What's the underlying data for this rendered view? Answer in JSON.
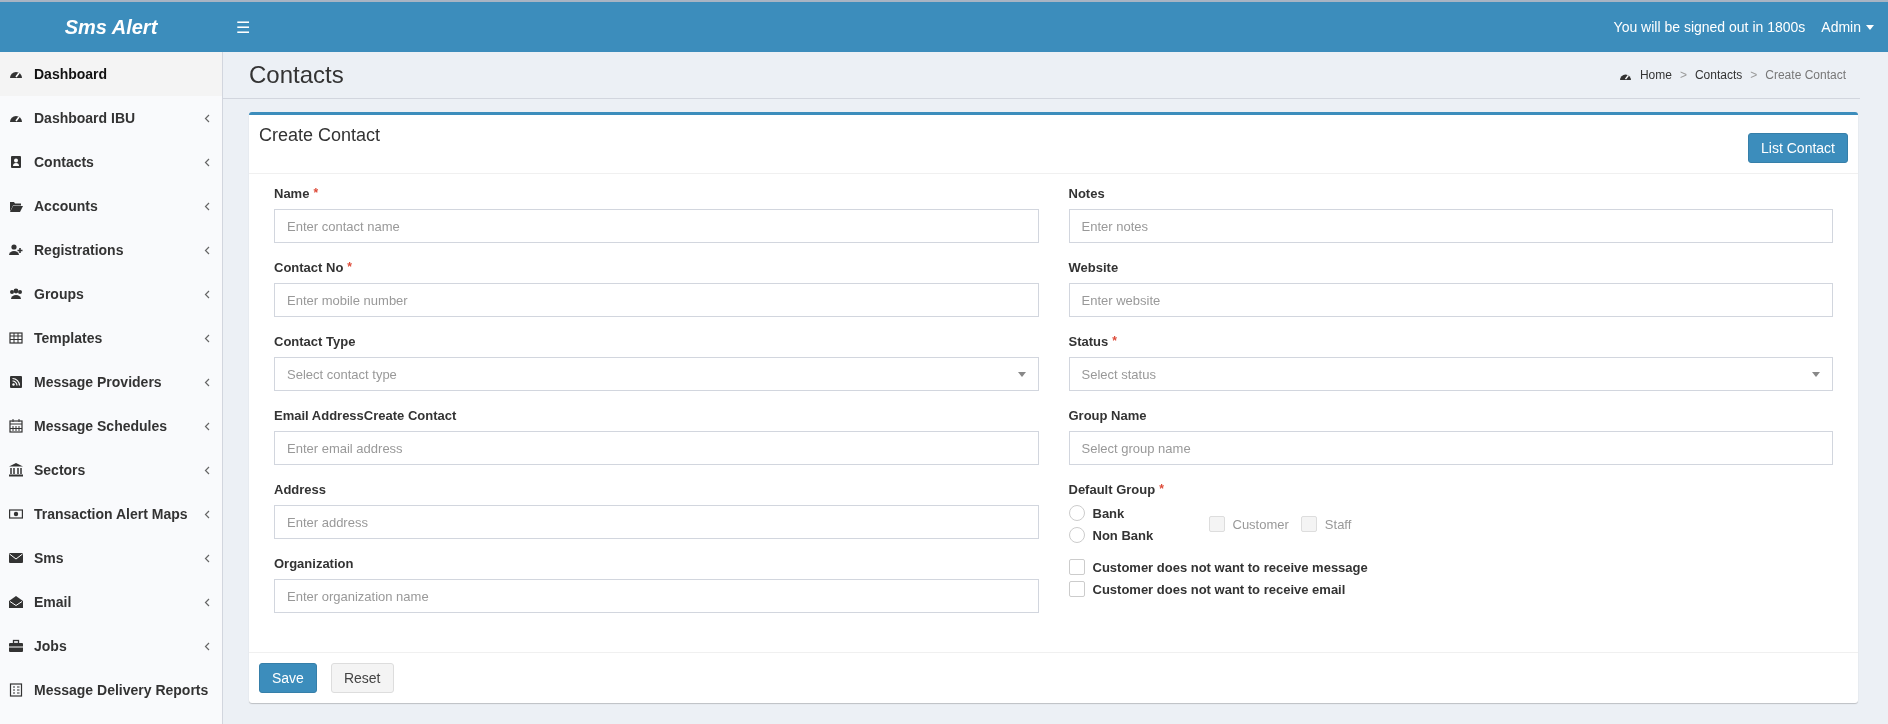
{
  "header": {
    "brand": "Sms Alert",
    "menu_toggle": "☰",
    "session_notice": "You will be signed out in 1800s",
    "user": "Admin"
  },
  "sidebar": {
    "items": [
      {
        "label": "Dashboard",
        "selected": true,
        "expandable": false
      },
      {
        "label": "Dashboard IBU",
        "selected": false,
        "expandable": true
      },
      {
        "label": "Contacts",
        "selected": false,
        "expandable": true
      },
      {
        "label": "Accounts",
        "selected": false,
        "expandable": true
      },
      {
        "label": "Registrations",
        "selected": false,
        "expandable": true
      },
      {
        "label": "Groups",
        "selected": false,
        "expandable": true
      },
      {
        "label": "Templates",
        "selected": false,
        "expandable": true
      },
      {
        "label": "Message Providers",
        "selected": false,
        "expandable": true
      },
      {
        "label": "Message Schedules",
        "selected": false,
        "expandable": true
      },
      {
        "label": "Sectors",
        "selected": false,
        "expandable": true
      },
      {
        "label": "Transaction Alert Maps",
        "selected": false,
        "expandable": true
      },
      {
        "label": "Sms",
        "selected": false,
        "expandable": true
      },
      {
        "label": "Email",
        "selected": false,
        "expandable": true
      },
      {
        "label": "Jobs",
        "selected": false,
        "expandable": true
      },
      {
        "label": "Message Delivery Reports",
        "selected": false,
        "expandable": false
      }
    ]
  },
  "page": {
    "title": "Contacts",
    "breadcrumb": [
      "Home",
      "Contacts",
      "Create Contact"
    ],
    "breadcrumb_separator": ">"
  },
  "form": {
    "title": "Create Contact",
    "list_button": "List Contact",
    "left_fields": [
      {
        "kind": "text",
        "label": "Name",
        "required_mark": "*",
        "placeholder": "Enter contact name"
      },
      {
        "kind": "text",
        "label": "Contact No",
        "required_mark": "*",
        "placeholder": "Enter mobile number"
      },
      {
        "kind": "select",
        "label": "Contact Type",
        "placeholder": "Select contact type"
      },
      {
        "kind": "text",
        "label": "Email AddressCreate Contact",
        "placeholder": "Enter email address"
      },
      {
        "kind": "text",
        "label": "Address",
        "placeholder": "Enter address"
      },
      {
        "kind": "text",
        "label": "Organization",
        "placeholder": "Enter organization name"
      }
    ],
    "right_fields": [
      {
        "kind": "text",
        "label": "Notes",
        "placeholder": "Enter notes"
      },
      {
        "kind": "text",
        "label": "Website",
        "placeholder": "Enter website"
      },
      {
        "kind": "select",
        "label": "Status",
        "required_mark": "*",
        "placeholder": "Select status"
      },
      {
        "kind": "text",
        "label": "Group Name",
        "placeholder": "Select group name"
      }
    ],
    "default_group": {
      "label": "Default Group",
      "required_mark": "*",
      "radios": [
        {
          "label": "Bank",
          "selected": false
        },
        {
          "label": "Non Bank",
          "selected": false
        }
      ],
      "options": [
        {
          "label": "Customer",
          "checked": false,
          "disabled": true
        },
        {
          "label": "Staff",
          "checked": false,
          "disabled": true
        }
      ]
    },
    "preferences": [
      {
        "label": "Customer does not want to receive message",
        "checked": false
      },
      {
        "label": "Customer does not want to receive email",
        "checked": false
      }
    ],
    "buttons": [
      {
        "kind": "primary",
        "label": "Save"
      },
      {
        "kind": "default",
        "label": "Reset"
      }
    ]
  }
}
